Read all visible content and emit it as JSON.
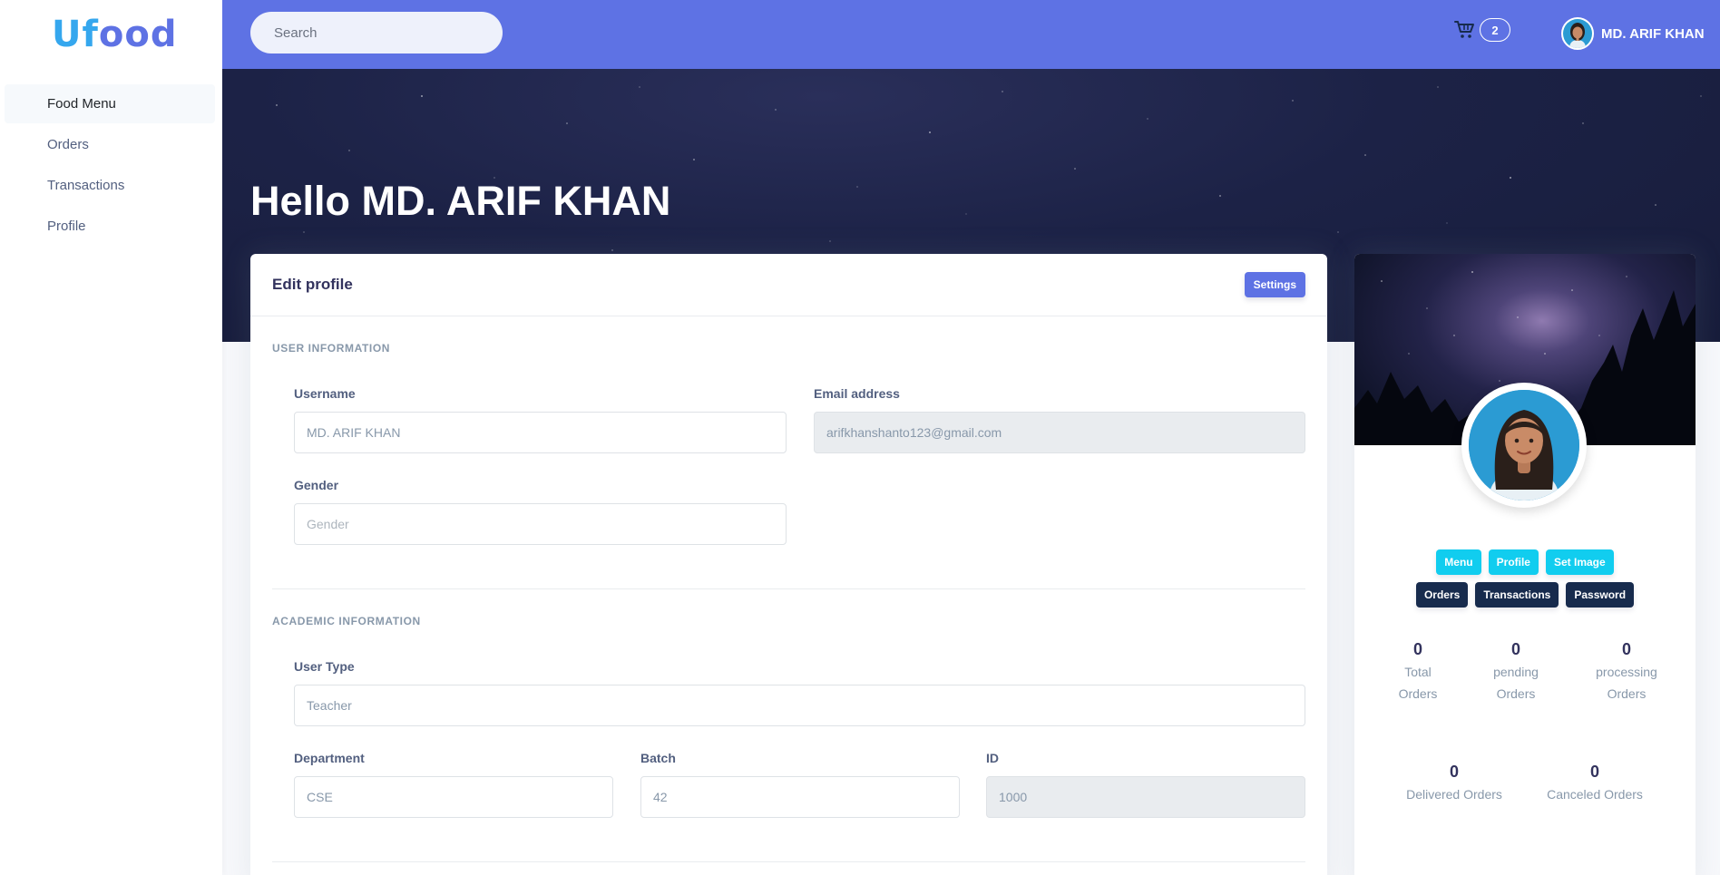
{
  "brand": {
    "logo_part1": "Uf",
    "logo_part2": "ood",
    "logo_accent": "#35a7ee"
  },
  "sidebar": {
    "items": [
      {
        "label": "Food Menu",
        "active": true
      },
      {
        "label": "Orders",
        "active": false
      },
      {
        "label": "Transactions",
        "active": false
      },
      {
        "label": "Profile",
        "active": false
      }
    ]
  },
  "topbar": {
    "search_placeholder": "Search",
    "cart_icon": "cart-icon",
    "cart_count": "2",
    "user_name": "MD. ARIF KHAN",
    "bg_color": "#5e72e4"
  },
  "hero": {
    "greeting": "Hello MD. ARIF KHAN"
  },
  "edit_profile": {
    "title": "Edit profile",
    "settings_label": "Settings",
    "user_section": {
      "heading": "USER INFORMATION",
      "username_label": "Username",
      "username_value": "MD. ARIF KHAN",
      "email_label": "Email address",
      "email_value": "arifkhanshanto123@gmail.com",
      "gender_label": "Gender",
      "gender_placeholder": "Gender"
    },
    "academic_section": {
      "heading": "ACADEMIC INFORMATION",
      "user_type_label": "User Type",
      "user_type_value": "Teacher",
      "department_label": "Department",
      "department_value": "CSE",
      "batch_label": "Batch",
      "batch_value": "42",
      "id_label": "ID",
      "id_value": "1000"
    }
  },
  "profile_card": {
    "buttons_row1": [
      "Menu",
      "Profile",
      "Set Image"
    ],
    "buttons_row2": [
      "Orders",
      "Transactions",
      "Password"
    ],
    "stats": [
      {
        "value": "0",
        "label1": "Total",
        "label2": "Orders"
      },
      {
        "value": "0",
        "label1": "pending",
        "label2": "Orders"
      },
      {
        "value": "0",
        "label1": "processing",
        "label2": "Orders"
      },
      {
        "value": "0",
        "label1": "Delivered Orders"
      },
      {
        "value": "0",
        "label1": "Canceled Orders"
      }
    ]
  }
}
